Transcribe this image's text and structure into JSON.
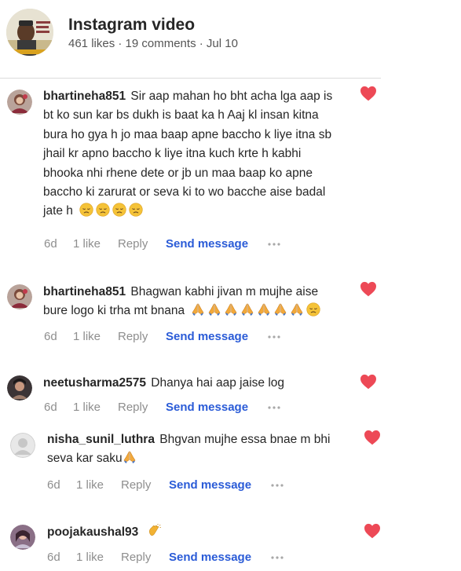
{
  "post": {
    "title": "Instagram video",
    "meta": "461 likes · 19 comments · Jul 10"
  },
  "icons": {
    "heart": "heart-icon",
    "more": "more-options-icon",
    "pray": "folded-hands-emoji",
    "sad": "pensive-face-emoji",
    "clap": "clapping-hands-emoji"
  },
  "colors": {
    "heart": "#ed4956",
    "send_message": "#2a5bd7",
    "meta": "#8e8e8e"
  },
  "comments": [
    {
      "username": "bhartineha851",
      "lines": [
        "Sir aap mahan ho bht acha lga aap is",
        "bt ko sun kar bs dukh is baat ka h Aaj kl insan kitna",
        "bura ho gya h jo maa baap apne baccho k liye itna sb",
        "jhail kr apno baccho k liye itna kuch krte h kabhi",
        "bhooka nhi rhene dete or jb un maa baap ko apne",
        "baccho ki zarurat or seva ki to wo bacche aise badal",
        "jate h"
      ],
      "time": "6d",
      "likes": "1 like",
      "reply": "Reply",
      "send": "Send message"
    },
    {
      "username": "bhartineha851",
      "lines": [
        "Bhagwan kabhi jivan m mujhe aise",
        "bure logo ki trha mt bnana"
      ],
      "time": "6d",
      "likes": "1 like",
      "reply": "Reply",
      "send": "Send message"
    },
    {
      "username": "neetusharma2575",
      "lines": [
        "Dhanya hai aap jaise log"
      ],
      "time": "6d",
      "likes": "1 like",
      "reply": "Reply",
      "send": "Send message"
    },
    {
      "username": "nisha_sunil_luthra",
      "lines": [
        "Bhgvan mujhe essa bnae m bhi",
        "seva kar saku"
      ],
      "time": "6d",
      "likes": "1 like",
      "reply": "Reply",
      "send": "Send message"
    },
    {
      "username": "poojakaushal93",
      "lines": [
        ""
      ],
      "time": "6d",
      "likes": "1 like",
      "reply": "Reply",
      "send": "Send message"
    }
  ]
}
